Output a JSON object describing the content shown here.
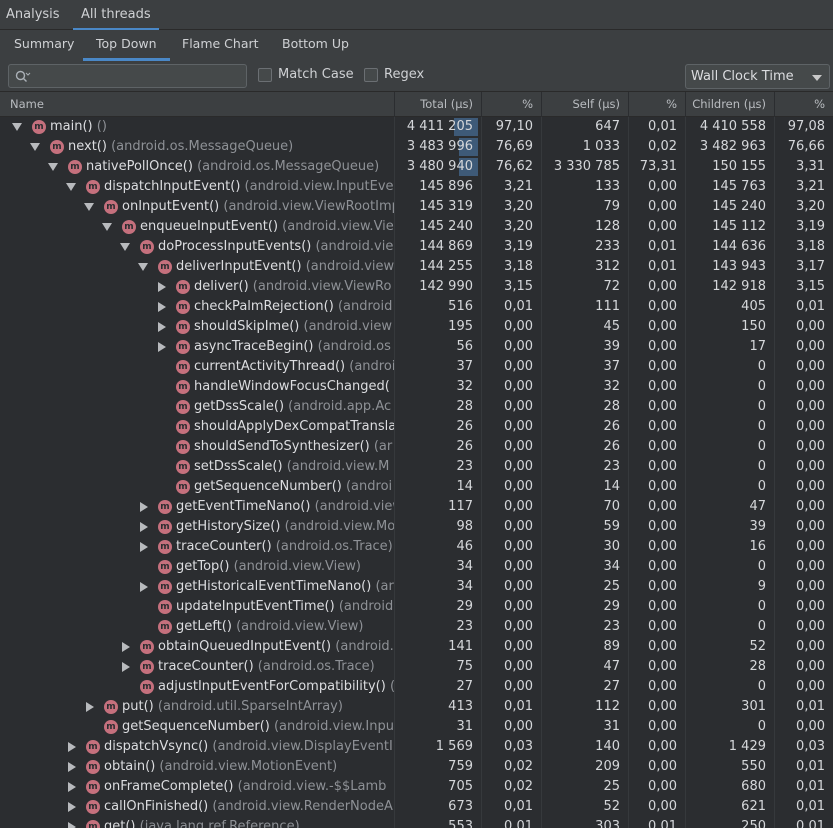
{
  "top_tabs": [
    {
      "label": "Analysis",
      "active": false
    },
    {
      "label": "All threads",
      "active": true
    }
  ],
  "sub_tabs": [
    {
      "label": "Summary",
      "active": false
    },
    {
      "label": "Top Down",
      "active": true
    },
    {
      "label": "Flame Chart",
      "active": false
    },
    {
      "label": "Bottom Up",
      "active": false
    }
  ],
  "toolbar": {
    "search_value": "",
    "search_placeholder": "",
    "match_case_label": "Match Case",
    "match_case_checked": false,
    "regex_label": "Regex",
    "regex_checked": false,
    "clock_selected": "Wall Clock Time"
  },
  "columns": [
    "Name",
    "Total (µs)",
    "%",
    "Self (µs)",
    "%",
    "Children (µs)",
    "%"
  ],
  "colors": {
    "accent": "#4a88c7",
    "method_icon": "#c5707d",
    "highlight": "#3e5a78",
    "background": "#2b2d30",
    "class_text": "#8e9196"
  },
  "rows": [
    {
      "depth": 0,
      "expander": "open",
      "name": "main()",
      "cls": "()",
      "total": "4 411 205",
      "total_pct": "97,10",
      "self": "647",
      "self_pct": "0,01",
      "children": "4 410 558",
      "children_pct": "97,08",
      "highlight": 0.28
    },
    {
      "depth": 1,
      "expander": "open",
      "name": "next()",
      "cls": "(android.os.MessageQueue)",
      "total": "3 483 996",
      "total_pct": "76,69",
      "self": "1 033",
      "self_pct": "0,02",
      "children": "3 482 963",
      "children_pct": "76,66",
      "highlight": 0.22
    },
    {
      "depth": 2,
      "expander": "open",
      "name": "nativePollOnce()",
      "cls": "(android.os.MessageQueue)",
      "total": "3 480 940",
      "total_pct": "76,62",
      "self": "3 330 785",
      "self_pct": "73,31",
      "children": "150 155",
      "children_pct": "3,31",
      "highlight": 0.22
    },
    {
      "depth": 3,
      "expander": "open",
      "name": "dispatchInputEvent()",
      "cls": "(android.view.InputEve",
      "total": "145 896",
      "total_pct": "3,21",
      "self": "133",
      "self_pct": "0,00",
      "children": "145 763",
      "children_pct": "3,21",
      "highlight": 0
    },
    {
      "depth": 4,
      "expander": "open",
      "name": "onInputEvent()",
      "cls": "(android.view.ViewRootImp",
      "total": "145 319",
      "total_pct": "3,20",
      "self": "79",
      "self_pct": "0,00",
      "children": "145 240",
      "children_pct": "3,20",
      "highlight": 0
    },
    {
      "depth": 5,
      "expander": "open",
      "name": "enqueueInputEvent()",
      "cls": "(android.view.View",
      "total": "145 240",
      "total_pct": "3,20",
      "self": "128",
      "self_pct": "0,00",
      "children": "145 112",
      "children_pct": "3,19",
      "highlight": 0
    },
    {
      "depth": 6,
      "expander": "open",
      "name": "doProcessInputEvents()",
      "cls": "(android.view",
      "total": "144 869",
      "total_pct": "3,19",
      "self": "233",
      "self_pct": "0,01",
      "children": "144 636",
      "children_pct": "3,18",
      "highlight": 0
    },
    {
      "depth": 7,
      "expander": "open",
      "name": "deliverInputEvent()",
      "cls": "(android.view",
      "total": "144 255",
      "total_pct": "3,18",
      "self": "312",
      "self_pct": "0,01",
      "children": "143 943",
      "children_pct": "3,17",
      "highlight": 0
    },
    {
      "depth": 8,
      "expander": "closed",
      "name": "deliver()",
      "cls": "(android.view.ViewRo",
      "total": "142 990",
      "total_pct": "3,15",
      "self": "72",
      "self_pct": "0,00",
      "children": "142 918",
      "children_pct": "3,15",
      "highlight": 0
    },
    {
      "depth": 8,
      "expander": "closed",
      "name": "checkPalmRejection()",
      "cls": "(android",
      "total": "516",
      "total_pct": "0,01",
      "self": "111",
      "self_pct": "0,00",
      "children": "405",
      "children_pct": "0,01",
      "highlight": 0
    },
    {
      "depth": 8,
      "expander": "closed",
      "name": "shouldSkipIme()",
      "cls": "(android.view",
      "total": "195",
      "total_pct": "0,00",
      "self": "45",
      "self_pct": "0,00",
      "children": "150",
      "children_pct": "0,00",
      "highlight": 0
    },
    {
      "depth": 8,
      "expander": "closed",
      "name": "asyncTraceBegin()",
      "cls": "(android.os",
      "total": "56",
      "total_pct": "0,00",
      "self": "39",
      "self_pct": "0,00",
      "children": "17",
      "children_pct": "0,00",
      "highlight": 0
    },
    {
      "depth": 8,
      "expander": "none",
      "name": "currentActivityThread()",
      "cls": "(androi",
      "total": "37",
      "total_pct": "0,00",
      "self": "37",
      "self_pct": "0,00",
      "children": "0",
      "children_pct": "0,00",
      "highlight": 0
    },
    {
      "depth": 8,
      "expander": "none",
      "name": "handleWindowFocusChanged(",
      "cls": "",
      "total": "32",
      "total_pct": "0,00",
      "self": "32",
      "self_pct": "0,00",
      "children": "0",
      "children_pct": "0,00",
      "highlight": 0
    },
    {
      "depth": 8,
      "expander": "none",
      "name": "getDssScale()",
      "cls": "(android.app.Ac",
      "total": "28",
      "total_pct": "0,00",
      "self": "28",
      "self_pct": "0,00",
      "children": "0",
      "children_pct": "0,00",
      "highlight": 0
    },
    {
      "depth": 8,
      "expander": "none",
      "name": "shouldApplyDexCompatTransla",
      "cls": "",
      "total": "26",
      "total_pct": "0,00",
      "self": "26",
      "self_pct": "0,00",
      "children": "0",
      "children_pct": "0,00",
      "highlight": 0
    },
    {
      "depth": 8,
      "expander": "none",
      "name": "shouldSendToSynthesizer()",
      "cls": "(ar",
      "total": "26",
      "total_pct": "0,00",
      "self": "26",
      "self_pct": "0,00",
      "children": "0",
      "children_pct": "0,00",
      "highlight": 0
    },
    {
      "depth": 8,
      "expander": "none",
      "name": "setDssScale()",
      "cls": "(android.view.M",
      "total": "23",
      "total_pct": "0,00",
      "self": "23",
      "self_pct": "0,00",
      "children": "0",
      "children_pct": "0,00",
      "highlight": 0
    },
    {
      "depth": 8,
      "expander": "none",
      "name": "getSequenceNumber()",
      "cls": "(androi",
      "total": "14",
      "total_pct": "0,00",
      "self": "14",
      "self_pct": "0,00",
      "children": "0",
      "children_pct": "0,00",
      "highlight": 0
    },
    {
      "depth": 7,
      "expander": "closed",
      "name": "getEventTimeNano()",
      "cls": "(android.view",
      "total": "117",
      "total_pct": "0,00",
      "self": "70",
      "self_pct": "0,00",
      "children": "47",
      "children_pct": "0,00",
      "highlight": 0
    },
    {
      "depth": 7,
      "expander": "closed",
      "name": "getHistorySize()",
      "cls": "(android.view.Mo",
      "total": "98",
      "total_pct": "0,00",
      "self": "59",
      "self_pct": "0,00",
      "children": "39",
      "children_pct": "0,00",
      "highlight": 0
    },
    {
      "depth": 7,
      "expander": "closed",
      "name": "traceCounter()",
      "cls": "(android.os.Trace)",
      "total": "46",
      "total_pct": "0,00",
      "self": "30",
      "self_pct": "0,00",
      "children": "16",
      "children_pct": "0,00",
      "highlight": 0
    },
    {
      "depth": 7,
      "expander": "none",
      "name": "getTop()",
      "cls": "(android.view.View)",
      "total": "34",
      "total_pct": "0,00",
      "self": "34",
      "self_pct": "0,00",
      "children": "0",
      "children_pct": "0,00",
      "highlight": 0
    },
    {
      "depth": 7,
      "expander": "closed",
      "name": "getHistoricalEventTimeNano()",
      "cls": "(ar",
      "total": "34",
      "total_pct": "0,00",
      "self": "25",
      "self_pct": "0,00",
      "children": "9",
      "children_pct": "0,00",
      "highlight": 0
    },
    {
      "depth": 7,
      "expander": "none",
      "name": "updateInputEventTime()",
      "cls": "(android.",
      "total": "29",
      "total_pct": "0,00",
      "self": "29",
      "self_pct": "0,00",
      "children": "0",
      "children_pct": "0,00",
      "highlight": 0
    },
    {
      "depth": 7,
      "expander": "none",
      "name": "getLeft()",
      "cls": "(android.view.View)",
      "total": "23",
      "total_pct": "0,00",
      "self": "23",
      "self_pct": "0,00",
      "children": "0",
      "children_pct": "0,00",
      "highlight": 0
    },
    {
      "depth": 6,
      "expander": "closed",
      "name": "obtainQueuedInputEvent()",
      "cls": "(android.",
      "total": "141",
      "total_pct": "0,00",
      "self": "89",
      "self_pct": "0,00",
      "children": "52",
      "children_pct": "0,00",
      "highlight": 0
    },
    {
      "depth": 6,
      "expander": "closed",
      "name": "traceCounter()",
      "cls": "(android.os.Trace)",
      "total": "75",
      "total_pct": "0,00",
      "self": "47",
      "self_pct": "0,00",
      "children": "28",
      "children_pct": "0,00",
      "highlight": 0
    },
    {
      "depth": 6,
      "expander": "none",
      "name": "adjustInputEventForCompatibility()",
      "cls": "(",
      "total": "27",
      "total_pct": "0,00",
      "self": "27",
      "self_pct": "0,00",
      "children": "0",
      "children_pct": "0,00",
      "highlight": 0
    },
    {
      "depth": 4,
      "expander": "closed",
      "name": "put()",
      "cls": "(android.util.SparseIntArray)",
      "total": "413",
      "total_pct": "0,01",
      "self": "112",
      "self_pct": "0,00",
      "children": "301",
      "children_pct": "0,01",
      "highlight": 0
    },
    {
      "depth": 4,
      "expander": "none",
      "name": "getSequenceNumber()",
      "cls": "(android.view.Inpu",
      "total": "31",
      "total_pct": "0,00",
      "self": "31",
      "self_pct": "0,00",
      "children": "0",
      "children_pct": "0,00",
      "highlight": 0
    },
    {
      "depth": 3,
      "expander": "closed",
      "name": "dispatchVsync()",
      "cls": "(android.view.DisplayEventI",
      "total": "1 569",
      "total_pct": "0,03",
      "self": "140",
      "self_pct": "0,00",
      "children": "1 429",
      "children_pct": "0,03",
      "highlight": 0
    },
    {
      "depth": 3,
      "expander": "closed",
      "name": "obtain()",
      "cls": "(android.view.MotionEvent)",
      "total": "759",
      "total_pct": "0,02",
      "self": "209",
      "self_pct": "0,00",
      "children": "550",
      "children_pct": "0,01",
      "highlight": 0
    },
    {
      "depth": 3,
      "expander": "closed",
      "name": "onFrameComplete()",
      "cls": "(android.view.-$$Lamb",
      "total": "705",
      "total_pct": "0,02",
      "self": "25",
      "self_pct": "0,00",
      "children": "680",
      "children_pct": "0,01",
      "highlight": 0
    },
    {
      "depth": 3,
      "expander": "closed",
      "name": "callOnFinished()",
      "cls": "(android.view.RenderNodeA",
      "total": "673",
      "total_pct": "0,01",
      "self": "52",
      "self_pct": "0,00",
      "children": "621",
      "children_pct": "0,01",
      "highlight": 0
    },
    {
      "depth": 3,
      "expander": "closed",
      "name": "get()",
      "cls": "(java.lang.ref.Reference)",
      "total": "553",
      "total_pct": "0,01",
      "self": "303",
      "self_pct": "0,01",
      "children": "250",
      "children_pct": "0,01",
      "highlight": 0
    }
  ]
}
